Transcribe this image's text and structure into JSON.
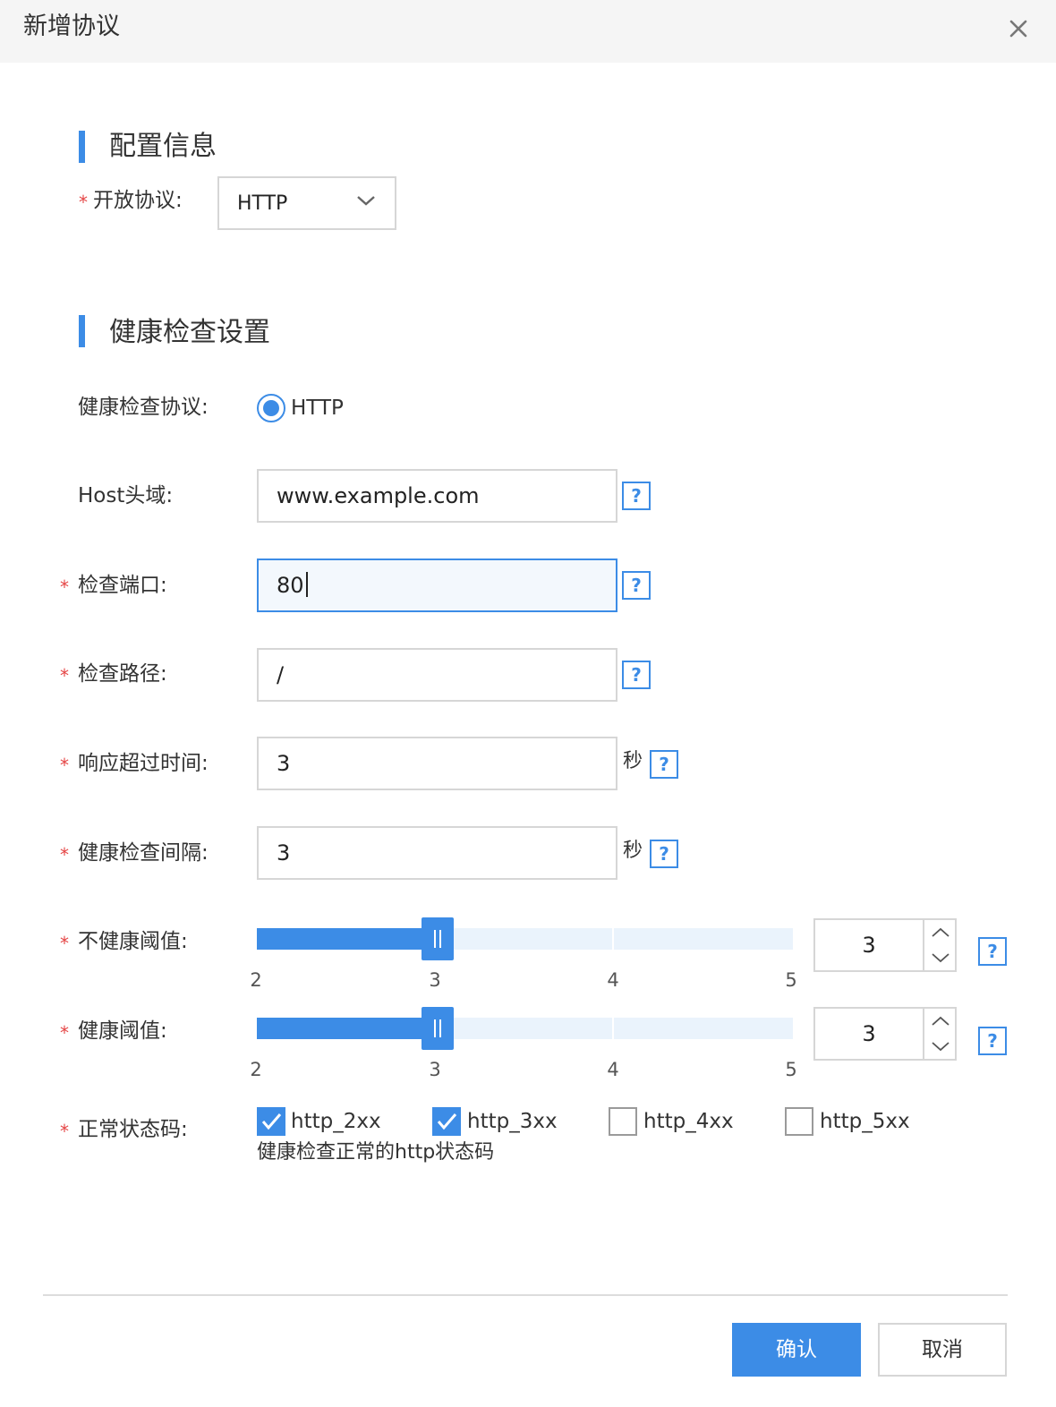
{
  "dialog": {
    "title": "新增协议",
    "close_icon": "close-icon"
  },
  "config_section": {
    "title": "配置信息",
    "protocol_label": "开放协议:",
    "protocol_value": "HTTP"
  },
  "health_section": {
    "title": "健康检查设置",
    "check_protocol_label": "健康检查协议:",
    "check_protocol_option": "HTTP",
    "host_label": "Host头域:",
    "host_value": "www.example.com",
    "port_label": "检查端口:",
    "port_value": "80",
    "path_label": "检查路径:",
    "path_value": "/",
    "timeout_label": "响应超过时间:",
    "timeout_value": "3",
    "timeout_unit": "秒",
    "interval_label": "健康检查间隔:",
    "interval_value": "3",
    "interval_unit": "秒",
    "unhealthy_label": "不健康阈值:",
    "unhealthy_value": "3",
    "unhealthy_ticks": [
      "2",
      "3",
      "4",
      "5"
    ],
    "healthy_label": "健康阈值:",
    "healthy_value": "3",
    "healthy_ticks": [
      "2",
      "3",
      "4",
      "5"
    ],
    "status_label": "正常状态码:",
    "status_codes": [
      {
        "label": "http_2xx",
        "checked": true
      },
      {
        "label": "http_3xx",
        "checked": true
      },
      {
        "label": "http_4xx",
        "checked": false
      },
      {
        "label": "http_5xx",
        "checked": false
      }
    ],
    "status_hint": "健康检查正常的http状态码",
    "required_mark": "*",
    "help_mark": "?"
  },
  "footer": {
    "confirm_label": "确认",
    "cancel_label": "取消"
  },
  "colors": {
    "accent": "#3c8ce6",
    "required": "#e54545",
    "header_bg": "#f5f5f5"
  }
}
